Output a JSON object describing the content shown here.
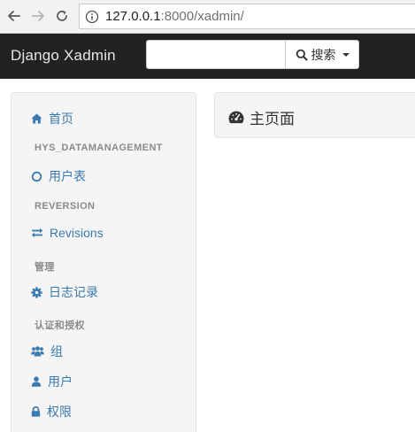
{
  "browser": {
    "url_host": "127.0.0.1",
    "url_path": ":8000/xadmin/"
  },
  "header": {
    "brand": "Django Xadmin",
    "search_placeholder": "",
    "search_label": "搜索"
  },
  "sidebar": {
    "home": "首页",
    "section_hys": "HYS_DATAMANAGEMENT",
    "user_table": "用户表",
    "section_reversion": "REVERSION",
    "revisions": "Revisions",
    "section_manage": "管理",
    "log": "日志记录",
    "section_auth": "认证和授权",
    "group": "组",
    "user": "用户",
    "permission": "权限"
  },
  "main": {
    "title": "主页面"
  },
  "colors": {
    "link": "#3a7ab2",
    "navbar": "#222222",
    "panel_bg": "#f5f5f5"
  }
}
